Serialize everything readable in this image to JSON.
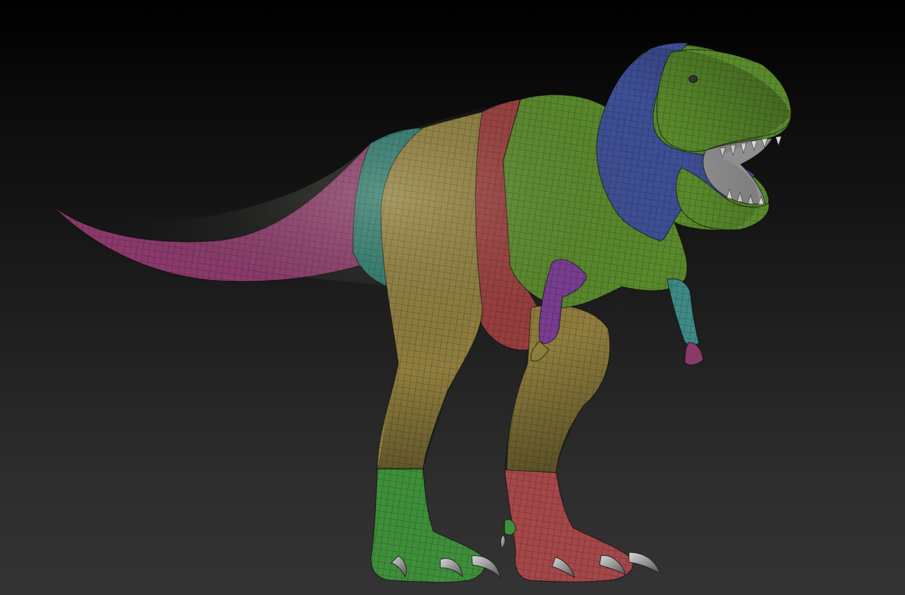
{
  "viewport": {
    "background_top": "#000000",
    "background_bottom": "#343434"
  },
  "model": {
    "subject": "t-rex-sculpt",
    "display_mode": "polygroups-wireframe",
    "polygroup_colors": {
      "head_body": "#5a8a2c",
      "neck_frill": "#3f4f96",
      "tail": "#8a3a6a",
      "tail_base": "#2f7a6e",
      "thighs": "#8f7e3e",
      "belly_band": "#9a3e3e",
      "left_foot": "#3f8f3a",
      "right_foot": "#a5484a",
      "arm_upper": "#7a3d94",
      "arm_lower": "#3e8a86",
      "mouth_interior": "#8f8f8f"
    }
  }
}
